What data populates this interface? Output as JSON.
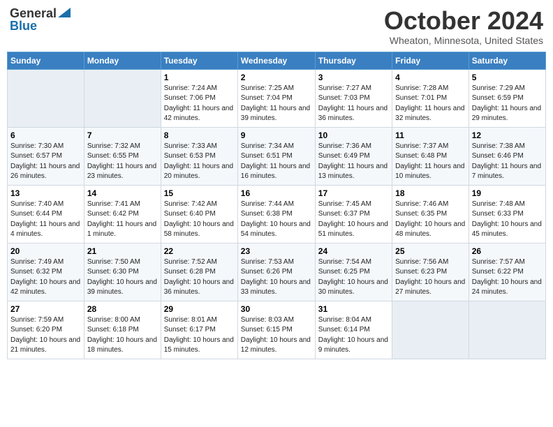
{
  "header": {
    "logo_general": "General",
    "logo_blue": "Blue",
    "title": "October 2024",
    "location": "Wheaton, Minnesota, United States"
  },
  "days_of_week": [
    "Sunday",
    "Monday",
    "Tuesday",
    "Wednesday",
    "Thursday",
    "Friday",
    "Saturday"
  ],
  "weeks": [
    [
      {
        "day": "",
        "sunrise": "",
        "sunset": "",
        "daylight": ""
      },
      {
        "day": "",
        "sunrise": "",
        "sunset": "",
        "daylight": ""
      },
      {
        "day": "1",
        "sunrise": "Sunrise: 7:24 AM",
        "sunset": "Sunset: 7:06 PM",
        "daylight": "Daylight: 11 hours and 42 minutes."
      },
      {
        "day": "2",
        "sunrise": "Sunrise: 7:25 AM",
        "sunset": "Sunset: 7:04 PM",
        "daylight": "Daylight: 11 hours and 39 minutes."
      },
      {
        "day": "3",
        "sunrise": "Sunrise: 7:27 AM",
        "sunset": "Sunset: 7:03 PM",
        "daylight": "Daylight: 11 hours and 36 minutes."
      },
      {
        "day": "4",
        "sunrise": "Sunrise: 7:28 AM",
        "sunset": "Sunset: 7:01 PM",
        "daylight": "Daylight: 11 hours and 32 minutes."
      },
      {
        "day": "5",
        "sunrise": "Sunrise: 7:29 AM",
        "sunset": "Sunset: 6:59 PM",
        "daylight": "Daylight: 11 hours and 29 minutes."
      }
    ],
    [
      {
        "day": "6",
        "sunrise": "Sunrise: 7:30 AM",
        "sunset": "Sunset: 6:57 PM",
        "daylight": "Daylight: 11 hours and 26 minutes."
      },
      {
        "day": "7",
        "sunrise": "Sunrise: 7:32 AM",
        "sunset": "Sunset: 6:55 PM",
        "daylight": "Daylight: 11 hours and 23 minutes."
      },
      {
        "day": "8",
        "sunrise": "Sunrise: 7:33 AM",
        "sunset": "Sunset: 6:53 PM",
        "daylight": "Daylight: 11 hours and 20 minutes."
      },
      {
        "day": "9",
        "sunrise": "Sunrise: 7:34 AM",
        "sunset": "Sunset: 6:51 PM",
        "daylight": "Daylight: 11 hours and 16 minutes."
      },
      {
        "day": "10",
        "sunrise": "Sunrise: 7:36 AM",
        "sunset": "Sunset: 6:49 PM",
        "daylight": "Daylight: 11 hours and 13 minutes."
      },
      {
        "day": "11",
        "sunrise": "Sunrise: 7:37 AM",
        "sunset": "Sunset: 6:48 PM",
        "daylight": "Daylight: 11 hours and 10 minutes."
      },
      {
        "day": "12",
        "sunrise": "Sunrise: 7:38 AM",
        "sunset": "Sunset: 6:46 PM",
        "daylight": "Daylight: 11 hours and 7 minutes."
      }
    ],
    [
      {
        "day": "13",
        "sunrise": "Sunrise: 7:40 AM",
        "sunset": "Sunset: 6:44 PM",
        "daylight": "Daylight: 11 hours and 4 minutes."
      },
      {
        "day": "14",
        "sunrise": "Sunrise: 7:41 AM",
        "sunset": "Sunset: 6:42 PM",
        "daylight": "Daylight: 11 hours and 1 minute."
      },
      {
        "day": "15",
        "sunrise": "Sunrise: 7:42 AM",
        "sunset": "Sunset: 6:40 PM",
        "daylight": "Daylight: 10 hours and 58 minutes."
      },
      {
        "day": "16",
        "sunrise": "Sunrise: 7:44 AM",
        "sunset": "Sunset: 6:38 PM",
        "daylight": "Daylight: 10 hours and 54 minutes."
      },
      {
        "day": "17",
        "sunrise": "Sunrise: 7:45 AM",
        "sunset": "Sunset: 6:37 PM",
        "daylight": "Daylight: 10 hours and 51 minutes."
      },
      {
        "day": "18",
        "sunrise": "Sunrise: 7:46 AM",
        "sunset": "Sunset: 6:35 PM",
        "daylight": "Daylight: 10 hours and 48 minutes."
      },
      {
        "day": "19",
        "sunrise": "Sunrise: 7:48 AM",
        "sunset": "Sunset: 6:33 PM",
        "daylight": "Daylight: 10 hours and 45 minutes."
      }
    ],
    [
      {
        "day": "20",
        "sunrise": "Sunrise: 7:49 AM",
        "sunset": "Sunset: 6:32 PM",
        "daylight": "Daylight: 10 hours and 42 minutes."
      },
      {
        "day": "21",
        "sunrise": "Sunrise: 7:50 AM",
        "sunset": "Sunset: 6:30 PM",
        "daylight": "Daylight: 10 hours and 39 minutes."
      },
      {
        "day": "22",
        "sunrise": "Sunrise: 7:52 AM",
        "sunset": "Sunset: 6:28 PM",
        "daylight": "Daylight: 10 hours and 36 minutes."
      },
      {
        "day": "23",
        "sunrise": "Sunrise: 7:53 AM",
        "sunset": "Sunset: 6:26 PM",
        "daylight": "Daylight: 10 hours and 33 minutes."
      },
      {
        "day": "24",
        "sunrise": "Sunrise: 7:54 AM",
        "sunset": "Sunset: 6:25 PM",
        "daylight": "Daylight: 10 hours and 30 minutes."
      },
      {
        "day": "25",
        "sunrise": "Sunrise: 7:56 AM",
        "sunset": "Sunset: 6:23 PM",
        "daylight": "Daylight: 10 hours and 27 minutes."
      },
      {
        "day": "26",
        "sunrise": "Sunrise: 7:57 AM",
        "sunset": "Sunset: 6:22 PM",
        "daylight": "Daylight: 10 hours and 24 minutes."
      }
    ],
    [
      {
        "day": "27",
        "sunrise": "Sunrise: 7:59 AM",
        "sunset": "Sunset: 6:20 PM",
        "daylight": "Daylight: 10 hours and 21 minutes."
      },
      {
        "day": "28",
        "sunrise": "Sunrise: 8:00 AM",
        "sunset": "Sunset: 6:18 PM",
        "daylight": "Daylight: 10 hours and 18 minutes."
      },
      {
        "day": "29",
        "sunrise": "Sunrise: 8:01 AM",
        "sunset": "Sunset: 6:17 PM",
        "daylight": "Daylight: 10 hours and 15 minutes."
      },
      {
        "day": "30",
        "sunrise": "Sunrise: 8:03 AM",
        "sunset": "Sunset: 6:15 PM",
        "daylight": "Daylight: 10 hours and 12 minutes."
      },
      {
        "day": "31",
        "sunrise": "Sunrise: 8:04 AM",
        "sunset": "Sunset: 6:14 PM",
        "daylight": "Daylight: 10 hours and 9 minutes."
      },
      {
        "day": "",
        "sunrise": "",
        "sunset": "",
        "daylight": ""
      },
      {
        "day": "",
        "sunrise": "",
        "sunset": "",
        "daylight": ""
      }
    ]
  ]
}
